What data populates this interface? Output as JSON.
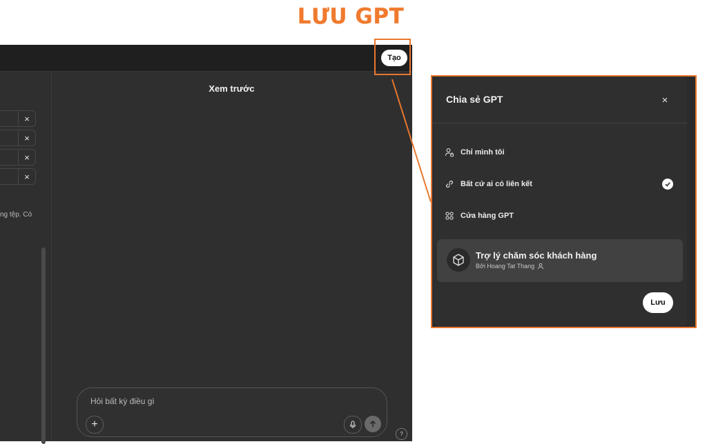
{
  "heading": "LƯU GPT",
  "topbar": {
    "create_label": "Tạo"
  },
  "preview": {
    "title": "Xem trước"
  },
  "left_panel": {
    "remove_symbol": "×",
    "hint_text": "ng tệp. Có"
  },
  "composer": {
    "placeholder": "Hỏi bất kỳ điều gì",
    "plus_symbol": "+",
    "help_symbol": "?"
  },
  "share_dialog": {
    "title": "Chia sẻ GPT",
    "close_symbol": "×",
    "options": [
      {
        "label": "Chỉ mình tôi",
        "icon": "person-lock-icon",
        "selected": false
      },
      {
        "label": "Bất cứ ai có liên kết",
        "icon": "link-icon",
        "selected": true
      },
      {
        "label": "Cửa hàng GPT",
        "icon": "grid-apps-icon",
        "selected": false
      }
    ],
    "gpt": {
      "name": "Trợ lý chăm sóc khách hàng",
      "author": "Bởi Hoang Tat Thang",
      "icon": "cube-icon"
    },
    "save_label": "Lưu"
  },
  "colors": {
    "accent": "#e8772e",
    "app_bg": "#2f2f2f",
    "topbar_bg": "#1f1f1f",
    "card_bg": "#414141"
  }
}
